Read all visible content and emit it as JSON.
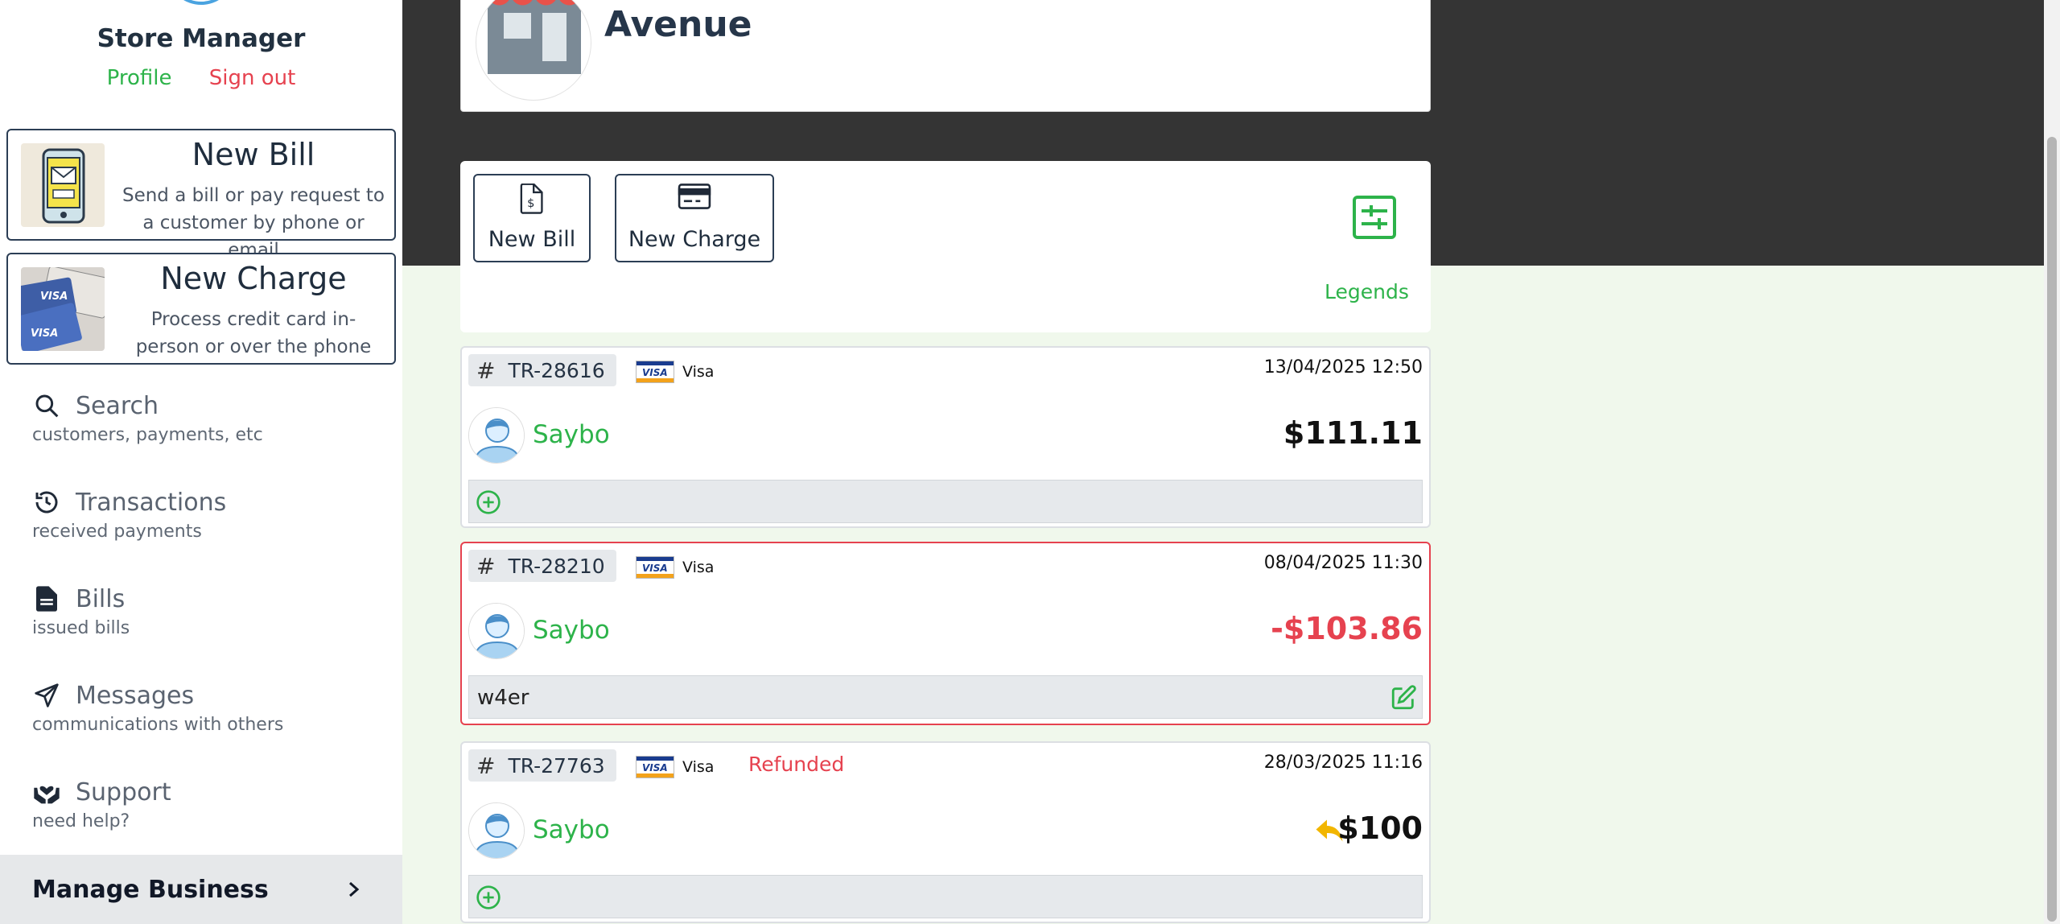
{
  "sidebar": {
    "user_title": "Store Manager",
    "profile_link": "Profile",
    "signout_link": "Sign out",
    "actions": [
      {
        "title": "New Bill",
        "description": "Send a bill or pay request to a customer by phone or email",
        "icon": "phone-bill-image"
      },
      {
        "title": "New Charge",
        "description": "Process credit card in-person or over the phone",
        "icon": "visa-cards-image"
      }
    ],
    "nav": [
      {
        "label": "Search",
        "sub": "customers, payments, etc",
        "icon": "search-icon"
      },
      {
        "label": "Transactions",
        "sub": "received payments",
        "icon": "history-icon"
      },
      {
        "label": "Bills",
        "sub": "issued bills",
        "icon": "document-icon"
      },
      {
        "label": "Messages",
        "sub": "communications with others",
        "icon": "send-icon"
      },
      {
        "label": "Support",
        "sub": "need help?",
        "icon": "support-hands-icon"
      }
    ],
    "manage_business": "Manage Business"
  },
  "store": {
    "name": "Avenue"
  },
  "toolbar": {
    "new_bill": "New Bill",
    "new_charge": "New Charge",
    "legends": "Legends"
  },
  "transactions": [
    {
      "id": "TR-28616",
      "card": "Visa",
      "status": "",
      "date": "13/04/2025 12:50",
      "customer": "Saybo",
      "amount": "$111.11",
      "note": ""
    },
    {
      "id": "TR-28210",
      "card": "Visa",
      "status": "",
      "date": "08/04/2025 11:30",
      "customer": "Saybo",
      "amount": "-$103.86",
      "note": "w4er"
    },
    {
      "id": "TR-27763",
      "card": "Visa",
      "status": "Refunded",
      "date": "28/03/2025 11:16",
      "customer": "Saybo",
      "amount": "$100",
      "note": ""
    }
  ],
  "colors": {
    "accent_green": "#2db34a",
    "danger_red": "#e6424f",
    "header_dark": "#343434",
    "refund_yellow": "#f2b600"
  }
}
